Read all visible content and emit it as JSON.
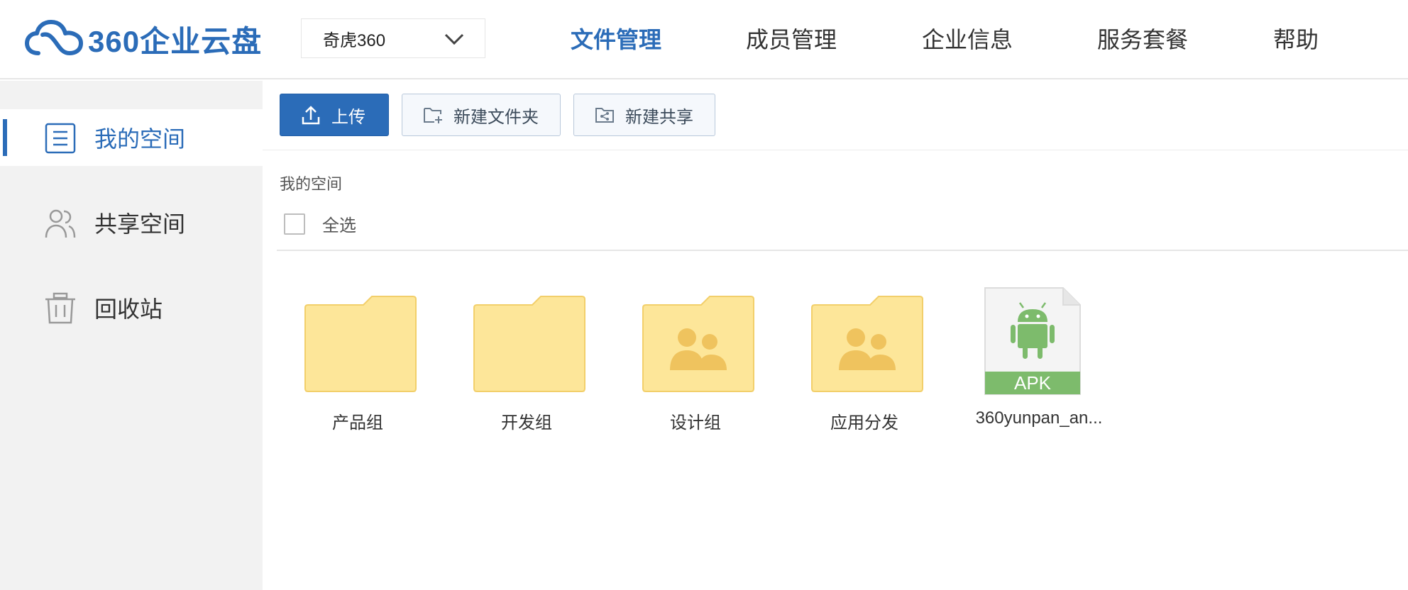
{
  "header": {
    "logo_text": "360企业云盘",
    "org_select": {
      "value": "奇虎360"
    },
    "nav": [
      {
        "label": "文件管理",
        "active": true
      },
      {
        "label": "成员管理",
        "active": false
      },
      {
        "label": "企业信息",
        "active": false
      },
      {
        "label": "服务套餐",
        "active": false
      },
      {
        "label": "帮助",
        "active": false
      }
    ]
  },
  "sidebar": {
    "items": [
      {
        "label": "我的空间",
        "icon": "document-list-icon",
        "active": true
      },
      {
        "label": "共享空间",
        "icon": "users-icon",
        "active": false
      },
      {
        "label": "回收站",
        "icon": "trash-icon",
        "active": false
      }
    ]
  },
  "toolbar": {
    "upload_label": "上传",
    "new_folder_label": "新建文件夹",
    "new_share_label": "新建共享"
  },
  "breadcrumb": "我的空间",
  "select_all_label": "全选",
  "files": [
    {
      "name": "产品组",
      "type": "folder"
    },
    {
      "name": "开发组",
      "type": "folder"
    },
    {
      "name": "设计组",
      "type": "shared-folder"
    },
    {
      "name": "应用分发",
      "type": "shared-folder"
    },
    {
      "name": "360yunpan_an...",
      "type": "apk",
      "badge": "APK"
    }
  ],
  "colors": {
    "accent": "#2b6cb8",
    "folder": "#fde699",
    "folder_edge": "#f2cf6a",
    "shared_figure": "#efc35e",
    "android": "#7dbb6c"
  }
}
